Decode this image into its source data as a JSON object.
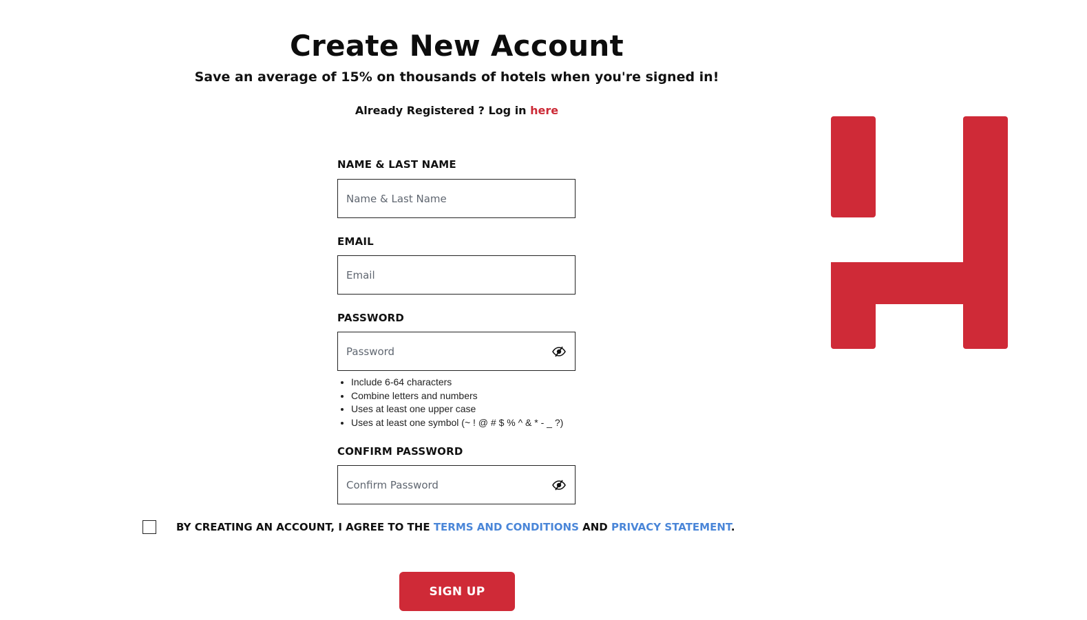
{
  "header": {
    "title": "Create New Account",
    "subtitle": "Save an average of 15% on thousands of hotels when you're signed in!",
    "already_registered": "Already Registered ? Log in ",
    "login_link": "here"
  },
  "form": {
    "name": {
      "label": "NAME & LAST NAME",
      "placeholder": "Name & Last Name",
      "value": ""
    },
    "email": {
      "label": "EMAIL",
      "placeholder": "Email",
      "value": ""
    },
    "password": {
      "label": "PASSWORD",
      "placeholder": "Password",
      "value": "",
      "rules": [
        "Include 6-64 characters",
        "Combine letters and numbers",
        "Uses at least one upper case",
        "Uses at least one symbol (~ ! @ # $ % ^ & * - _ ?)"
      ]
    },
    "confirm_password": {
      "label": "CONFIRM PASSWORD",
      "placeholder": "Confirm Password",
      "value": ""
    },
    "terms": {
      "prefix": "BY CREATING AN ACCOUNT, I AGREE TO THE ",
      "terms_link": "TERMS AND CONDITIONS",
      "middle": " AND ",
      "privacy_link": "PRIVACY STATEMENT",
      "suffix": ".",
      "checked": false
    },
    "submit_label": "SIGN UP"
  },
  "icons": {
    "password_toggle": "eye-slash-icon",
    "brand_logo": "h-logo"
  },
  "colors": {
    "brand_red": "#cf2a37",
    "link_red": "#cc2a36",
    "link_blue": "#4a86d8"
  }
}
